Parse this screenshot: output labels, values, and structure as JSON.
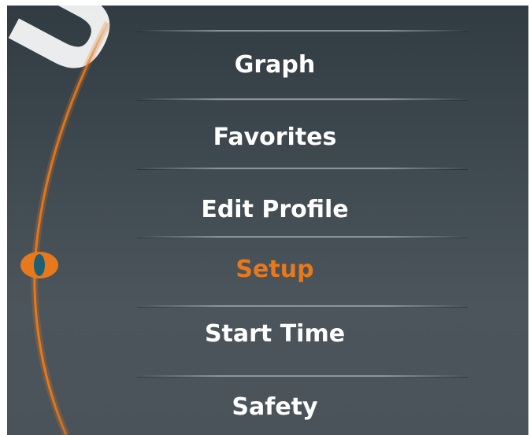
{
  "watermark": "UTSC",
  "menu": {
    "items": [
      {
        "label": "Graph",
        "active": false
      },
      {
        "label": "Favorites",
        "active": false
      },
      {
        "label": "Edit Profile",
        "active": false
      },
      {
        "label": "Setup",
        "active": true
      },
      {
        "label": "Start Time",
        "active": false
      },
      {
        "label": "Safety",
        "active": false
      }
    ],
    "selected_index": 3
  },
  "colors": {
    "accent": "#e8781c",
    "text": "#ffffff",
    "background": "#3c464d",
    "indicator_inner": "#1f5f73"
  },
  "icons": {
    "selector": "selection-eye-icon"
  }
}
